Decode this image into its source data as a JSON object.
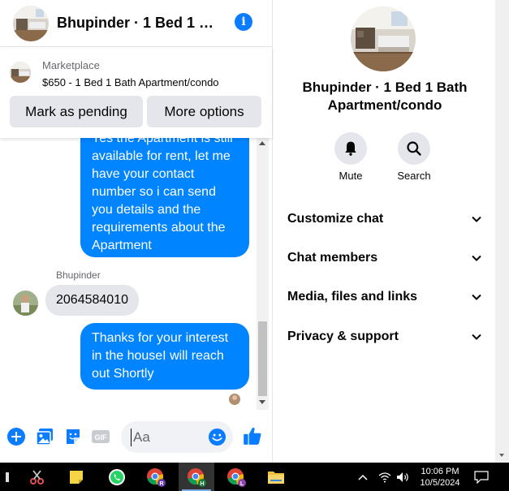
{
  "chat": {
    "header_name": "Bhupinder · 1 Bed 1 B...",
    "marketplace_label": "Marketplace",
    "listing_title": "$650 - 1 Bed 1 Bath Apartment/condo",
    "mark_pending_label": "Mark as pending",
    "more_options_label": "More options",
    "messages": {
      "outgoing_1": "Yes the Apartment is still available for rent, let me have your contact number so i can send you details and the requirements about the Apartment",
      "incoming_sender": "Bhupinder",
      "incoming_1": "2064584010",
      "outgoing_2": "Thanks for your interest in the houseI will reach out Shortly"
    },
    "composer_placeholder": "Aa"
  },
  "info": {
    "title": "Bhupinder · 1 Bed 1 Bath Apartment/condo",
    "mute_label": "Mute",
    "search_label": "Search",
    "menu": {
      "customize": "Customize chat",
      "members": "Chat members",
      "media": "Media, files and links",
      "privacy": "Privacy & support"
    }
  },
  "taskbar": {
    "time": "10:06 PM",
    "date": "10/5/2024",
    "chrome_badges": [
      "R",
      "H",
      "L"
    ]
  },
  "colors": {
    "messenger_blue": "#0084ff",
    "accent_blue": "#0a7cff",
    "gray_bubble": "#e4e6eb"
  }
}
